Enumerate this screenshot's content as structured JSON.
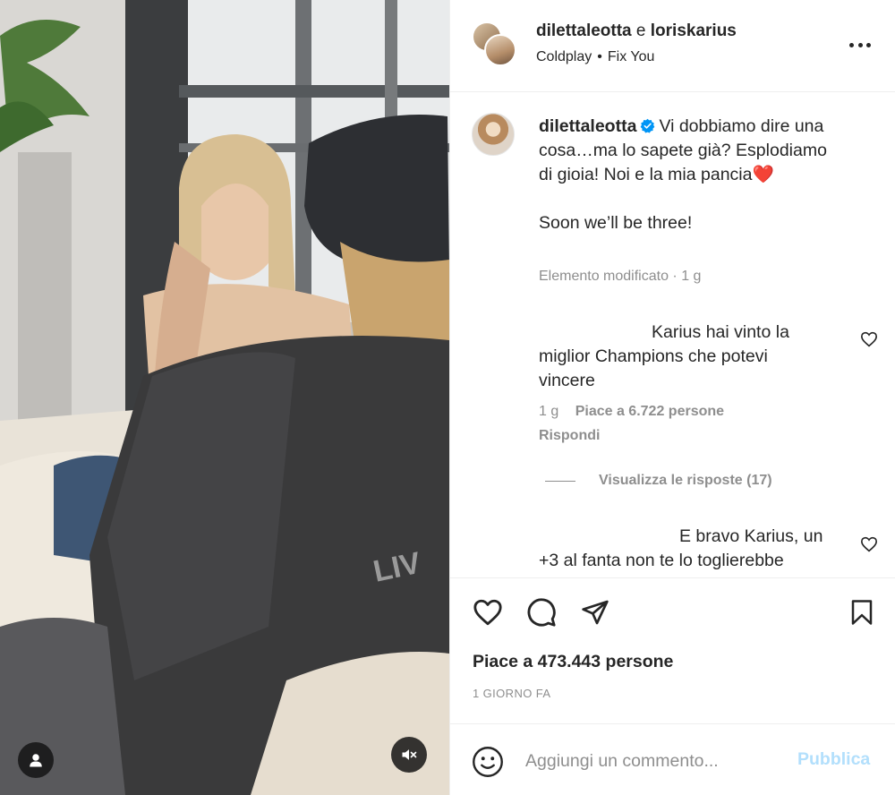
{
  "colors": {
    "accent": "#0095f6",
    "accent_disabled": "#b2dffc",
    "text": "#262626",
    "secondary": "#8e8e8e",
    "like_red": "#ed4956"
  },
  "media": {
    "user_tag_icon": "user-icon",
    "mute_icon": "speaker-muted-icon"
  },
  "header": {
    "user1": "dilettaleotta",
    "joiner": "e",
    "user2": "loriskarius",
    "music_artist": "Coldplay",
    "music_separator": "•",
    "music_song": "Fix You",
    "more_icon": "more-horizontal-icon"
  },
  "caption": {
    "username": "dilettaleotta",
    "text": "Vi dobbiamo dire una cosa…ma lo sapete già? Esplodiamo di gioia! Noi e la mia pancia❤️",
    "text2": "Soon we’ll be three!",
    "edited": "Elemento modificato",
    "meta_separator": "·",
    "time": "1 g"
  },
  "comments": [
    {
      "text": "Karius hai vinto la miglior Champions che potevi vincere",
      "time": "1 g",
      "likes": "Piace a 6.722 persone",
      "reply": "Rispondi"
    },
    {
      "text": "E bravo Karius, un +3 al fanta non te lo toglierebbe"
    }
  ],
  "view_replies": "Visualizza le risposte (17)",
  "actions": {
    "like_icon": "heart-icon",
    "comment_icon": "comment-icon",
    "share_icon": "paper-plane-icon",
    "save_icon": "bookmark-icon",
    "likes": "Piace a 473.443 persone",
    "time_ago": "1 GIORNO FA"
  },
  "add_comment": {
    "emoji_icon": "emoji-icon",
    "placeholder": "Aggiungi un commento...",
    "publish": "Pubblica"
  }
}
